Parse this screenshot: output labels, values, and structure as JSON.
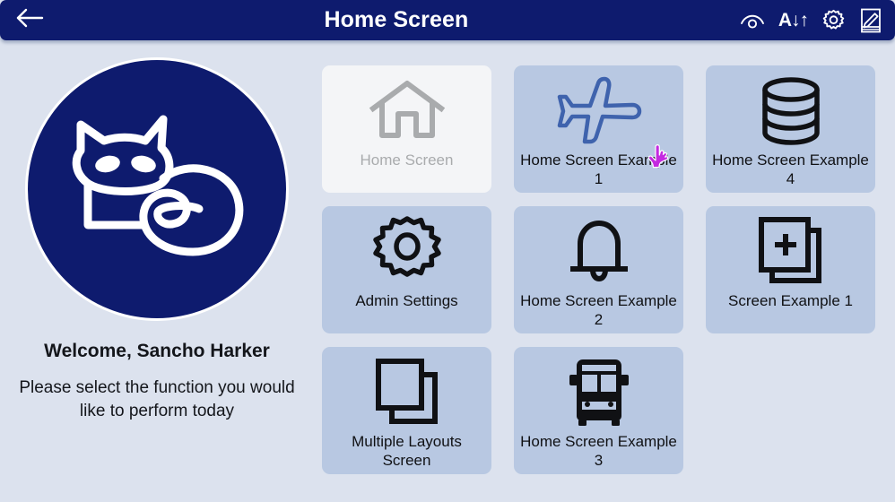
{
  "header": {
    "title": "Home Screen",
    "back_label": "Back",
    "back_icon": "arrow-left-icon",
    "actions": [
      {
        "name": "accessibility-eye-icon",
        "label": "Accessibility"
      },
      {
        "name": "text-size-icon",
        "label": "A",
        "down_arrow": "↓",
        "up_arrow": "↑"
      },
      {
        "name": "gear-icon",
        "label": "Settings"
      },
      {
        "name": "edit-pen-icon",
        "label": "Edit"
      }
    ]
  },
  "sidebar": {
    "logo_icon": "cat-logo-icon",
    "welcome": "Welcome, Sancho Harker",
    "instruction": "Please select the function you would like to perform today"
  },
  "colors": {
    "header_bg": "#0e1b6e",
    "page_bg": "#dce2ee",
    "tile_bg": "#b8c8e2",
    "tile_disabled_bg": "#f4f5f7",
    "tile_disabled_fg": "#a9abad",
    "icon_black": "#101114",
    "plane_blue": "#3f63ad",
    "cursor_magenta": "#c42ae0"
  },
  "main": {
    "tiles": [
      {
        "label": "Home Screen",
        "icon": "house-icon",
        "state": "disabled"
      },
      {
        "label": "Home Screen Example 1",
        "icon": "airplane-icon",
        "state": "enabled",
        "hovered": true
      },
      {
        "label": "Home Screen Example 4",
        "icon": "database-icon",
        "state": "enabled"
      },
      {
        "label": "Admin Settings",
        "icon": "gear-icon",
        "state": "enabled"
      },
      {
        "label": "Home Screen Example 2",
        "icon": "bell-icon",
        "state": "enabled"
      },
      {
        "label": "Screen Example 1",
        "icon": "new-page-plus-icon",
        "state": "enabled"
      },
      {
        "label": "Multiple Layouts Screen",
        "icon": "copy-pages-icon",
        "state": "enabled"
      },
      {
        "label": "Home Screen Example 3",
        "icon": "bus-icon",
        "state": "enabled"
      }
    ]
  },
  "cursor": {
    "icon": "pointing-hand-cursor"
  }
}
